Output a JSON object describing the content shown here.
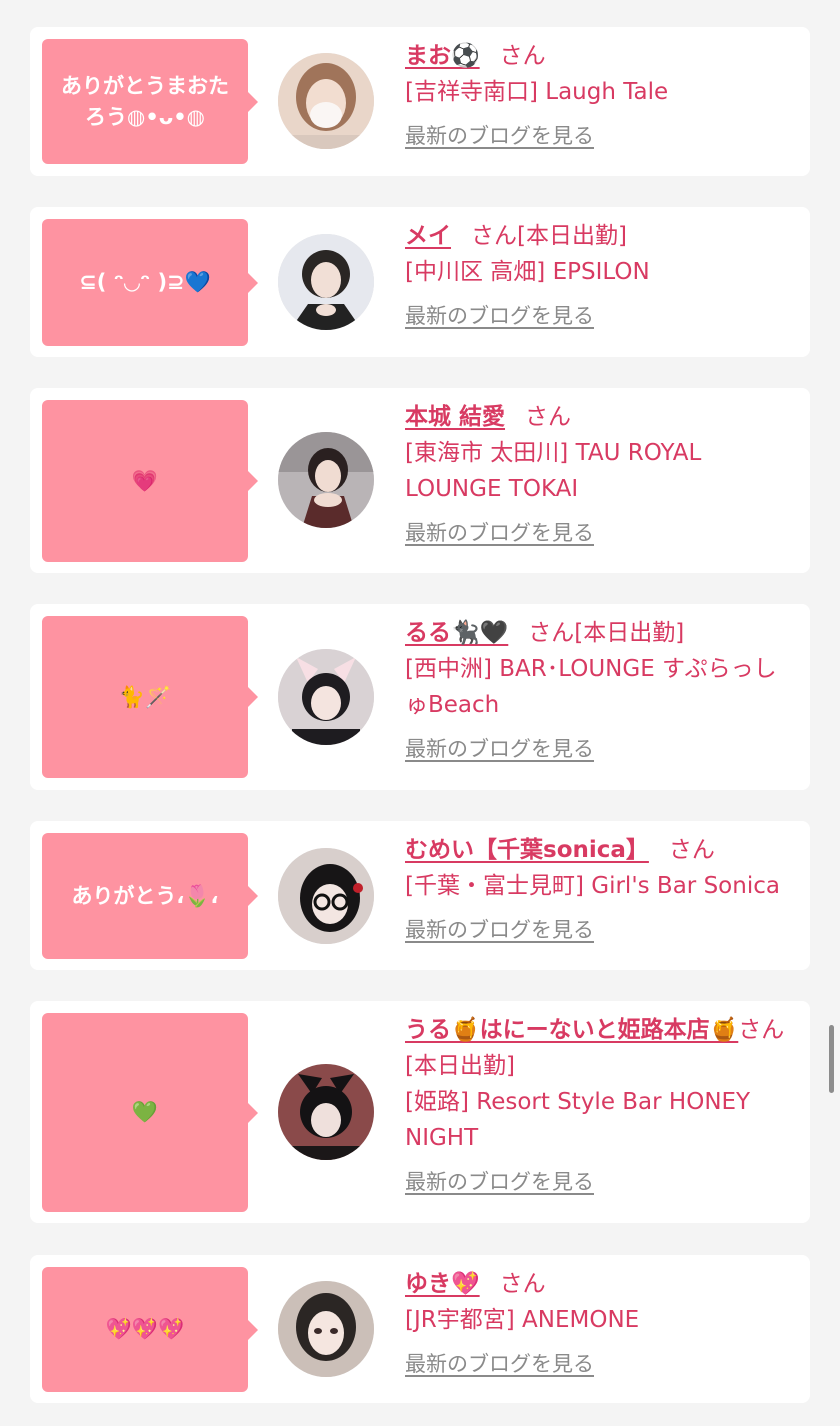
{
  "cards": [
    {
      "message": "ありがとうまおたろう◍•ᴗ•◍",
      "name": "まお⚽️",
      "honorific": "さん",
      "status": "",
      "shop": "[吉祥寺南口] Laugh Tale",
      "blog_link": "最新のブログを見る",
      "avatar_colors": [
        "#e9d6c9",
        "#a0745a"
      ]
    },
    {
      "message": "⊆( ᵔ◡ᵔ )⊇💙",
      "name": "メイ",
      "honorific": "さん",
      "status": "[本日出勤]",
      "shop": "[中川区 高畑] EPSILON",
      "blog_link": "最新のブログを見る",
      "avatar_colors": [
        "#e6e8ee",
        "#2a2624"
      ]
    },
    {
      "message": "💗",
      "name": "本城 結愛",
      "honorific": "さん",
      "status": "",
      "shop": "[東海市 太田川] TAU ROYAL LOUNGE TOKAI",
      "blog_link": "最新のブログを見る",
      "avatar_colors": [
        "#b9b4b6",
        "#5a2b2b"
      ]
    },
    {
      "message": "🐈🪄",
      "name": "るる🐈‍⬛🖤",
      "honorific": "さん",
      "status": "[本日出勤]",
      "shop": "[西中洲] BAR･LOUNGE すぷらっしゅBeach",
      "blog_link": "最新のブログを見る",
      "avatar_colors": [
        "#d9d2d4",
        "#1e1c20"
      ]
    },
    {
      "message": "ありがとう،🌷،",
      "name": "むめい【千葉sonica】",
      "honorific": "さん",
      "status": "",
      "shop": "[千葉・富士見町] Girl's Bar Sonica",
      "blog_link": "最新のブログを見る",
      "avatar_colors": [
        "#d8cfcc",
        "#171516"
      ]
    },
    {
      "message": "💚",
      "name": "うる🍯はにーないと姫路本店🍯",
      "honorific": "さん",
      "status": "[本日出勤]",
      "shop": "[姫路] Resort Style Bar HONEY NIGHT",
      "blog_link": "最新のブログを見る",
      "avatar_colors": [
        "#8a4a4a",
        "#141214"
      ]
    },
    {
      "message": "💖💖💖",
      "name": "ゆき💖",
      "honorific": "さん",
      "status": "",
      "shop": "[JR宇都宮] ANEMONE",
      "blog_link": "最新のブログを見る",
      "avatar_colors": [
        "#cbbfb8",
        "#2b2624"
      ]
    }
  ]
}
